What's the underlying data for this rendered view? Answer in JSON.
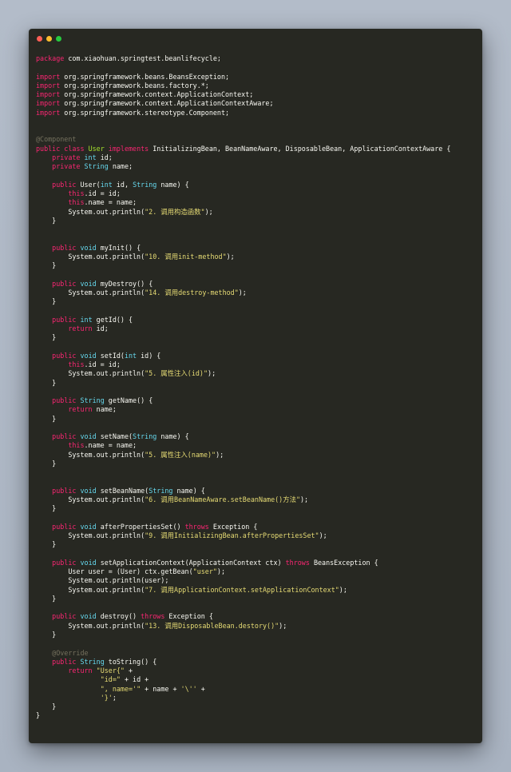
{
  "window": {
    "controls": [
      {
        "name": "close",
        "color": "#ff5f56"
      },
      {
        "name": "minimize",
        "color": "#ffbd2e"
      },
      {
        "name": "zoom",
        "color": "#27c93f"
      }
    ]
  },
  "theme": {
    "background": "#272822",
    "keyword": "#f92672",
    "type": "#66d9ef",
    "class_name": "#a6e22e",
    "string": "#e6db74",
    "comment": "#75715e",
    "plain": "#f8f8f2"
  },
  "code": {
    "language": "java",
    "lines": [
      [
        {
          "t": "kw",
          "v": "package"
        },
        {
          "t": "pl",
          "v": " com.xiaohuan.springtest.beanlifecycle;"
        }
      ],
      [],
      [
        {
          "t": "kw",
          "v": "import"
        },
        {
          "t": "pl",
          "v": " org.springframework.beans.BeansException;"
        }
      ],
      [
        {
          "t": "kw",
          "v": "import"
        },
        {
          "t": "pl",
          "v": " org.springframework.beans.factory.*;"
        }
      ],
      [
        {
          "t": "kw",
          "v": "import"
        },
        {
          "t": "pl",
          "v": " org.springframework.context.ApplicationContext;"
        }
      ],
      [
        {
          "t": "kw",
          "v": "import"
        },
        {
          "t": "pl",
          "v": " org.springframework.context.ApplicationContextAware;"
        }
      ],
      [
        {
          "t": "kw",
          "v": "import"
        },
        {
          "t": "pl",
          "v": " org.springframework.stereotype.Component;"
        }
      ],
      [],
      [],
      [
        {
          "t": "com",
          "v": "@Component"
        }
      ],
      [
        {
          "t": "kw",
          "v": "public class "
        },
        {
          "t": "cls",
          "v": "User"
        },
        {
          "t": "kw",
          "v": " implements"
        },
        {
          "t": "pl",
          "v": " InitializingBean, BeanNameAware, DisposableBean, ApplicationContextAware {"
        }
      ],
      [
        {
          "t": "pl",
          "v": "    "
        },
        {
          "t": "kw",
          "v": "private"
        },
        {
          "t": "pl",
          "v": " "
        },
        {
          "t": "type",
          "v": "int"
        },
        {
          "t": "pl",
          "v": " id;"
        }
      ],
      [
        {
          "t": "pl",
          "v": "    "
        },
        {
          "t": "kw",
          "v": "private"
        },
        {
          "t": "pl",
          "v": " "
        },
        {
          "t": "type",
          "v": "String"
        },
        {
          "t": "pl",
          "v": " name;"
        }
      ],
      [],
      [
        {
          "t": "pl",
          "v": "    "
        },
        {
          "t": "kw",
          "v": "public"
        },
        {
          "t": "pl",
          "v": " User("
        },
        {
          "t": "type",
          "v": "int"
        },
        {
          "t": "pl",
          "v": " id, "
        },
        {
          "t": "type",
          "v": "String"
        },
        {
          "t": "pl",
          "v": " name) {"
        }
      ],
      [
        {
          "t": "pl",
          "v": "        "
        },
        {
          "t": "kw",
          "v": "this"
        },
        {
          "t": "pl",
          "v": ".id = id;"
        }
      ],
      [
        {
          "t": "pl",
          "v": "        "
        },
        {
          "t": "kw",
          "v": "this"
        },
        {
          "t": "pl",
          "v": ".name = name;"
        }
      ],
      [
        {
          "t": "pl",
          "v": "        System.out.println("
        },
        {
          "t": "str",
          "v": "\"2. 调用构造函数\""
        },
        {
          "t": "pl",
          "v": ");"
        }
      ],
      [
        {
          "t": "pl",
          "v": "    }"
        }
      ],
      [],
      [],
      [
        {
          "t": "pl",
          "v": "    "
        },
        {
          "t": "kw",
          "v": "public"
        },
        {
          "t": "pl",
          "v": " "
        },
        {
          "t": "type",
          "v": "void"
        },
        {
          "t": "pl",
          "v": " myInit() {"
        }
      ],
      [
        {
          "t": "pl",
          "v": "        System.out.println("
        },
        {
          "t": "str",
          "v": "\"10. 调用init-method\""
        },
        {
          "t": "pl",
          "v": ");"
        }
      ],
      [
        {
          "t": "pl",
          "v": "    }"
        }
      ],
      [],
      [
        {
          "t": "pl",
          "v": "    "
        },
        {
          "t": "kw",
          "v": "public"
        },
        {
          "t": "pl",
          "v": " "
        },
        {
          "t": "type",
          "v": "void"
        },
        {
          "t": "pl",
          "v": " myDestroy() {"
        }
      ],
      [
        {
          "t": "pl",
          "v": "        System.out.println("
        },
        {
          "t": "str",
          "v": "\"14. 调用destroy-method\""
        },
        {
          "t": "pl",
          "v": ");"
        }
      ],
      [
        {
          "t": "pl",
          "v": "    }"
        }
      ],
      [],
      [
        {
          "t": "pl",
          "v": "    "
        },
        {
          "t": "kw",
          "v": "public"
        },
        {
          "t": "pl",
          "v": " "
        },
        {
          "t": "type",
          "v": "int"
        },
        {
          "t": "pl",
          "v": " getId() {"
        }
      ],
      [
        {
          "t": "pl",
          "v": "        "
        },
        {
          "t": "kw",
          "v": "return"
        },
        {
          "t": "pl",
          "v": " id;"
        }
      ],
      [
        {
          "t": "pl",
          "v": "    }"
        }
      ],
      [],
      [
        {
          "t": "pl",
          "v": "    "
        },
        {
          "t": "kw",
          "v": "public"
        },
        {
          "t": "pl",
          "v": " "
        },
        {
          "t": "type",
          "v": "void"
        },
        {
          "t": "pl",
          "v": " setId("
        },
        {
          "t": "type",
          "v": "int"
        },
        {
          "t": "pl",
          "v": " id) {"
        }
      ],
      [
        {
          "t": "pl",
          "v": "        "
        },
        {
          "t": "kw",
          "v": "this"
        },
        {
          "t": "pl",
          "v": ".id = id;"
        }
      ],
      [
        {
          "t": "pl",
          "v": "        System.out.println("
        },
        {
          "t": "str",
          "v": "\"5. 属性注入(id)\""
        },
        {
          "t": "pl",
          "v": ");"
        }
      ],
      [
        {
          "t": "pl",
          "v": "    }"
        }
      ],
      [],
      [
        {
          "t": "pl",
          "v": "    "
        },
        {
          "t": "kw",
          "v": "public"
        },
        {
          "t": "pl",
          "v": " "
        },
        {
          "t": "type",
          "v": "String"
        },
        {
          "t": "pl",
          "v": " getName() {"
        }
      ],
      [
        {
          "t": "pl",
          "v": "        "
        },
        {
          "t": "kw",
          "v": "return"
        },
        {
          "t": "pl",
          "v": " name;"
        }
      ],
      [
        {
          "t": "pl",
          "v": "    }"
        }
      ],
      [],
      [
        {
          "t": "pl",
          "v": "    "
        },
        {
          "t": "kw",
          "v": "public"
        },
        {
          "t": "pl",
          "v": " "
        },
        {
          "t": "type",
          "v": "void"
        },
        {
          "t": "pl",
          "v": " setName("
        },
        {
          "t": "type",
          "v": "String"
        },
        {
          "t": "pl",
          "v": " name) {"
        }
      ],
      [
        {
          "t": "pl",
          "v": "        "
        },
        {
          "t": "kw",
          "v": "this"
        },
        {
          "t": "pl",
          "v": ".name = name;"
        }
      ],
      [
        {
          "t": "pl",
          "v": "        System.out.println("
        },
        {
          "t": "str",
          "v": "\"5. 属性注入(name)\""
        },
        {
          "t": "pl",
          "v": ");"
        }
      ],
      [
        {
          "t": "pl",
          "v": "    }"
        }
      ],
      [],
      [],
      [
        {
          "t": "pl",
          "v": "    "
        },
        {
          "t": "kw",
          "v": "public"
        },
        {
          "t": "pl",
          "v": " "
        },
        {
          "t": "type",
          "v": "void"
        },
        {
          "t": "pl",
          "v": " setBeanName("
        },
        {
          "t": "type",
          "v": "String"
        },
        {
          "t": "pl",
          "v": " name) {"
        }
      ],
      [
        {
          "t": "pl",
          "v": "        System.out.println("
        },
        {
          "t": "str",
          "v": "\"6. 调用BeanNameAware.setBeanName()方法\""
        },
        {
          "t": "pl",
          "v": ");"
        }
      ],
      [
        {
          "t": "pl",
          "v": "    }"
        }
      ],
      [],
      [
        {
          "t": "pl",
          "v": "    "
        },
        {
          "t": "kw",
          "v": "public"
        },
        {
          "t": "pl",
          "v": " "
        },
        {
          "t": "type",
          "v": "void"
        },
        {
          "t": "pl",
          "v": " afterPropertiesSet() "
        },
        {
          "t": "kw",
          "v": "throws"
        },
        {
          "t": "pl",
          "v": " Exception {"
        }
      ],
      [
        {
          "t": "pl",
          "v": "        System.out.println("
        },
        {
          "t": "str",
          "v": "\"9. 调用InitializingBean.afterPropertiesSet\""
        },
        {
          "t": "pl",
          "v": ");"
        }
      ],
      [
        {
          "t": "pl",
          "v": "    }"
        }
      ],
      [],
      [
        {
          "t": "pl",
          "v": "    "
        },
        {
          "t": "kw",
          "v": "public"
        },
        {
          "t": "pl",
          "v": " "
        },
        {
          "t": "type",
          "v": "void"
        },
        {
          "t": "pl",
          "v": " setApplicationContext(ApplicationContext ctx) "
        },
        {
          "t": "kw",
          "v": "throws"
        },
        {
          "t": "pl",
          "v": " BeansException {"
        }
      ],
      [
        {
          "t": "pl",
          "v": "        User user = (User) ctx.getBean("
        },
        {
          "t": "str",
          "v": "\"user\""
        },
        {
          "t": "pl",
          "v": ");"
        }
      ],
      [
        {
          "t": "pl",
          "v": "        System.out.println(user);"
        }
      ],
      [
        {
          "t": "pl",
          "v": "        System.out.println("
        },
        {
          "t": "str",
          "v": "\"7. 调用ApplicationContext.setApplicationContext\""
        },
        {
          "t": "pl",
          "v": ");"
        }
      ],
      [
        {
          "t": "pl",
          "v": "    }"
        }
      ],
      [],
      [
        {
          "t": "pl",
          "v": "    "
        },
        {
          "t": "kw",
          "v": "public"
        },
        {
          "t": "pl",
          "v": " "
        },
        {
          "t": "type",
          "v": "void"
        },
        {
          "t": "pl",
          "v": " destroy() "
        },
        {
          "t": "kw",
          "v": "throws"
        },
        {
          "t": "pl",
          "v": " Exception {"
        }
      ],
      [
        {
          "t": "pl",
          "v": "        System.out.println("
        },
        {
          "t": "str",
          "v": "\"13. 调用DisposableBean.destory()\""
        },
        {
          "t": "pl",
          "v": ");"
        }
      ],
      [
        {
          "t": "pl",
          "v": "    }"
        }
      ],
      [],
      [
        {
          "t": "pl",
          "v": "    "
        },
        {
          "t": "com",
          "v": "@Override"
        }
      ],
      [
        {
          "t": "pl",
          "v": "    "
        },
        {
          "t": "kw",
          "v": "public"
        },
        {
          "t": "pl",
          "v": " "
        },
        {
          "t": "type",
          "v": "String"
        },
        {
          "t": "pl",
          "v": " toString() {"
        }
      ],
      [
        {
          "t": "pl",
          "v": "        "
        },
        {
          "t": "kw",
          "v": "return"
        },
        {
          "t": "pl",
          "v": " "
        },
        {
          "t": "str",
          "v": "\"User{\""
        },
        {
          "t": "pl",
          "v": " +"
        }
      ],
      [
        {
          "t": "pl",
          "v": "                "
        },
        {
          "t": "str",
          "v": "\"id=\""
        },
        {
          "t": "pl",
          "v": " + id +"
        }
      ],
      [
        {
          "t": "pl",
          "v": "                "
        },
        {
          "t": "str",
          "v": "\", name='\""
        },
        {
          "t": "pl",
          "v": " + name + "
        },
        {
          "t": "str",
          "v": "'\\''"
        },
        {
          "t": "pl",
          "v": " +"
        }
      ],
      [
        {
          "t": "pl",
          "v": "                "
        },
        {
          "t": "str",
          "v": "'}'"
        },
        {
          "t": "pl",
          "v": ";"
        }
      ],
      [
        {
          "t": "pl",
          "v": "    }"
        }
      ],
      [
        {
          "t": "pl",
          "v": "}"
        }
      ]
    ]
  }
}
